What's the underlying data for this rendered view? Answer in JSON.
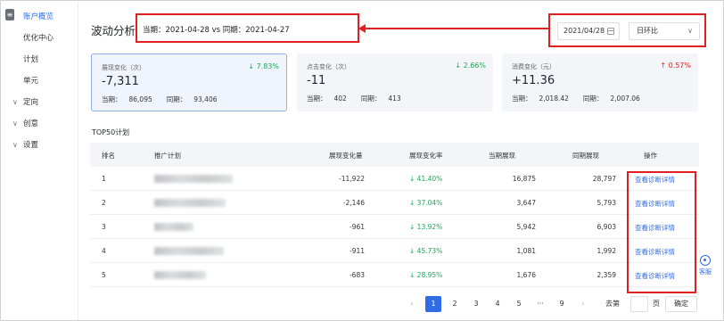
{
  "sidebar": {
    "items": [
      {
        "label": "账户概览",
        "active": true,
        "expandable": false
      },
      {
        "label": "优化中心",
        "active": false,
        "expandable": false
      },
      {
        "label": "计划",
        "active": false,
        "expandable": false
      },
      {
        "label": "单元",
        "active": false,
        "expandable": false
      },
      {
        "label": "定向",
        "active": false,
        "expandable": true
      },
      {
        "label": "创意",
        "active": false,
        "expandable": true
      },
      {
        "label": "设置",
        "active": false,
        "expandable": true
      }
    ]
  },
  "header": {
    "title": "波动分析",
    "period_text": "当期：2021-04-28 vs 同期：2021-04-27",
    "date_value": "2021/04/28",
    "compare_select": "日环比"
  },
  "cards": [
    {
      "label": "展现变化（次）",
      "change": "↓ 7.83%",
      "direction": "down",
      "value": "-7,311",
      "current_label": "当期：",
      "current": "86,095",
      "prev_label": "同期：",
      "prev": "93,406"
    },
    {
      "label": "点击变化（次）",
      "change": "↓ 2.66%",
      "direction": "down",
      "value": "-11",
      "current_label": "当期：",
      "current": "402",
      "prev_label": "同期：",
      "prev": "413"
    },
    {
      "label": "消费变化（元）",
      "change": "↑ 0.57%",
      "direction": "up",
      "value": "+11.36",
      "current_label": "当期：",
      "current": "2,018.42",
      "prev_label": "同期：",
      "prev": "2,007.06"
    }
  ],
  "table": {
    "title": "TOP50计划",
    "headers": [
      "排名",
      "推广计划",
      "展现变化量",
      "展现变化率",
      "当期展现",
      "同期展现",
      "操作"
    ],
    "rows": [
      {
        "rank": "1",
        "delta": "-11,922",
        "rate": "↓ 41.40%",
        "current": "16,875",
        "prev": "28,797",
        "action": "查看诊断详情"
      },
      {
        "rank": "2",
        "delta": "-2,146",
        "rate": "↓ 37.04%",
        "current": "3,647",
        "prev": "5,793",
        "action": "查看诊断详情"
      },
      {
        "rank": "3",
        "delta": "-961",
        "rate": "↓ 13.92%",
        "current": "5,942",
        "prev": "6,903",
        "action": "查看诊断详情"
      },
      {
        "rank": "4",
        "delta": "-911",
        "rate": "↓ 45.73%",
        "current": "1,081",
        "prev": "1,992",
        "action": "查看诊断详情"
      },
      {
        "rank": "5",
        "delta": "-683",
        "rate": "↓ 28.95%",
        "current": "1,676",
        "prev": "2,359",
        "action": "查看诊断详情"
      }
    ]
  },
  "pagination": {
    "prev": "‹",
    "pages": [
      "1",
      "2",
      "3",
      "4",
      "5",
      "···",
      "9"
    ],
    "active_page": "1",
    "next": "›",
    "goto_label": "去第",
    "page_suffix": "页",
    "confirm": "确定"
  },
  "float_widget": {
    "label": "客服"
  },
  "colors": {
    "accent": "#2f6de8",
    "down": "#1aaa55",
    "up": "#e02020",
    "highlight_box": "#e02020"
  }
}
